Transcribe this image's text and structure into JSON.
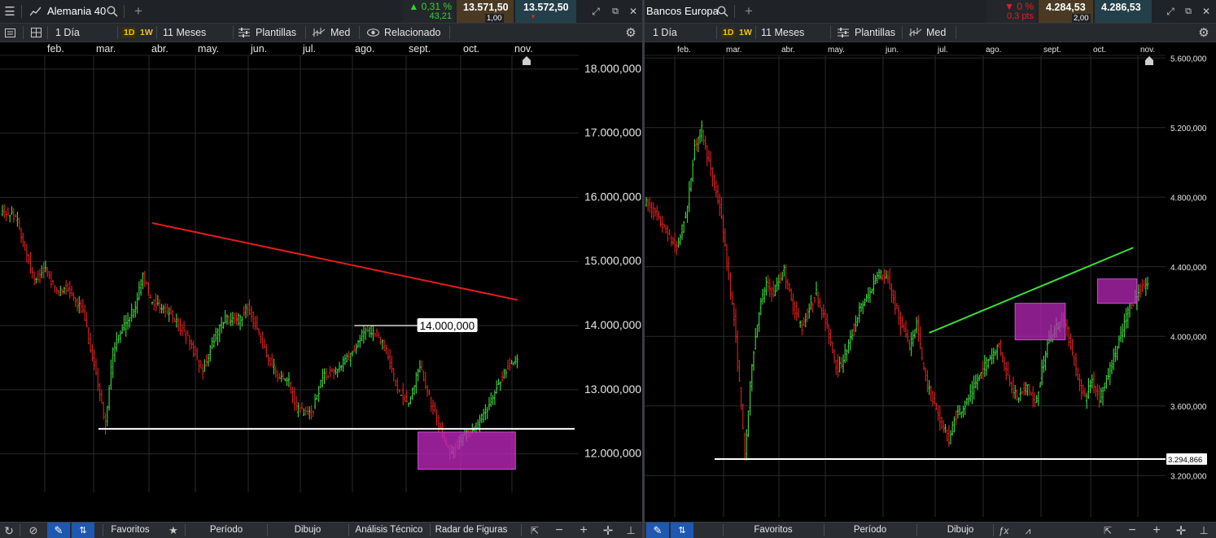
{
  "left": {
    "instrument": "Alemania 40",
    "change_pct": "0,31 %",
    "change_pts": "43,21",
    "bid": "13.571,50",
    "ask": "13.572,50",
    "spread": "1,00",
    "interval": "1 Día",
    "tf_1d": "1D",
    "tf_1w": "1W",
    "range": "11 Meses",
    "templates": "Plantillas",
    "indicator": "Med",
    "related": "Relacionado",
    "bottom": {
      "favorites": "Favoritos",
      "period": "Período",
      "drawing": "Dibujo",
      "technical": "Análisis Técnico",
      "pattern_radar": "Radar de Figuras"
    }
  },
  "right": {
    "instrument": "Bancos Europa",
    "change_pct": "0 %",
    "change_pts": "0,3 pts",
    "bid": "4.284,53",
    "ask": "4.286,53",
    "spread": "2,00",
    "interval": "1 Día",
    "tf_1d": "1D",
    "tf_1w": "1W",
    "range": "11 Meses",
    "templates": "Plantillas",
    "indicator": "Med",
    "bottom": {
      "favorites": "Favoritos",
      "period": "Período",
      "drawing": "Dibujo"
    }
  },
  "chart_data": [
    {
      "type": "ohlc",
      "instrument": "Alemania 40",
      "months": [
        "feb.",
        "mar.",
        "abr.",
        "may.",
        "jun.",
        "jul.",
        "ago.",
        "sept.",
        "oct.",
        "nov."
      ],
      "y_ticks": [
        "18.000,000",
        "17.000,000",
        "16.000,000",
        "15.000,000",
        "14.000,000",
        "13.000,000",
        "12.000,000"
      ],
      "ylim": [
        11500,
        18100
      ],
      "colors": {
        "up": "#3ddc3d",
        "down": "#e02020"
      },
      "anchors": [
        [
          0,
          15800
        ],
        [
          8,
          15700
        ],
        [
          12,
          15300
        ],
        [
          18,
          14700
        ],
        [
          24,
          14900
        ],
        [
          30,
          14500
        ],
        [
          36,
          14600
        ],
        [
          44,
          14200
        ],
        [
          52,
          13100
        ],
        [
          56,
          12450
        ],
        [
          60,
          13600
        ],
        [
          66,
          14000
        ],
        [
          72,
          14300
        ],
        [
          76,
          14800
        ],
        [
          80,
          14400
        ],
        [
          90,
          14200
        ],
        [
          100,
          13800
        ],
        [
          108,
          13300
        ],
        [
          114,
          13800
        ],
        [
          120,
          14100
        ],
        [
          128,
          14100
        ],
        [
          132,
          14300
        ],
        [
          140,
          13700
        ],
        [
          148,
          13200
        ],
        [
          154,
          13100
        ],
        [
          158,
          12700
        ],
        [
          166,
          12600
        ],
        [
          172,
          13200
        ],
        [
          178,
          13300
        ],
        [
          186,
          13500
        ],
        [
          194,
          13900
        ],
        [
          200,
          13900
        ],
        [
          206,
          13600
        ],
        [
          212,
          13000
        ],
        [
          218,
          12800
        ],
        [
          224,
          13400
        ],
        [
          230,
          12800
        ],
        [
          236,
          12300
        ],
        [
          240,
          12000
        ],
        [
          246,
          12200
        ],
        [
          252,
          12400
        ],
        [
          258,
          12600
        ],
        [
          264,
          13000
        ],
        [
          270,
          13300
        ],
        [
          275,
          13500
        ]
      ],
      "annotations": {
        "resistance_line": {
          "start_bar": 80,
          "start_price": 15600,
          "end_bar": 275,
          "end_price": 14400
        },
        "support_line_price": 12390,
        "level_line": {
          "price": 14000,
          "start_bar": 188,
          "end_bar": 222
        },
        "level_label": "14.000,000",
        "highlight_box": {
          "start_bar": 222,
          "end_bar": 274,
          "price_top": 12340,
          "price_bottom": 11760
        }
      }
    },
    {
      "type": "ohlc",
      "instrument": "Bancos Europa",
      "months": [
        "feb.",
        "mar.",
        "abr.",
        "may.",
        "jun.",
        "jul.",
        "ago.",
        "sept.",
        "oct.",
        "nov."
      ],
      "y_ticks": [
        "5.600,000",
        "5.200,000",
        "4.800,000",
        "4.400,000",
        "4.000,000",
        "3.600,000",
        "3.200,000"
      ],
      "ylim": [
        3000,
        5620
      ],
      "colors": {
        "up": "#3ddc3d",
        "down": "#e02020"
      },
      "anchors": [
        [
          0,
          4780
        ],
        [
          6,
          4700
        ],
        [
          12,
          4600
        ],
        [
          18,
          4500
        ],
        [
          24,
          4740
        ],
        [
          28,
          5100
        ],
        [
          32,
          5190
        ],
        [
          38,
          4900
        ],
        [
          42,
          4750
        ],
        [
          46,
          4420
        ],
        [
          50,
          4100
        ],
        [
          54,
          3600
        ],
        [
          56,
          3300
        ],
        [
          60,
          3850
        ],
        [
          64,
          4150
        ],
        [
          68,
          4300
        ],
        [
          72,
          4250
        ],
        [
          78,
          4380
        ],
        [
          82,
          4200
        ],
        [
          88,
          4050
        ],
        [
          96,
          4250
        ],
        [
          102,
          4050
        ],
        [
          108,
          3800
        ],
        [
          114,
          3950
        ],
        [
          120,
          4150
        ],
        [
          126,
          4250
        ],
        [
          130,
          4370
        ],
        [
          136,
          4320
        ],
        [
          142,
          4100
        ],
        [
          148,
          3950
        ],
        [
          152,
          4080
        ],
        [
          156,
          3800
        ],
        [
          160,
          3650
        ],
        [
          166,
          3500
        ],
        [
          170,
          3400
        ],
        [
          174,
          3550
        ],
        [
          180,
          3620
        ],
        [
          186,
          3750
        ],
        [
          192,
          3870
        ],
        [
          198,
          3950
        ],
        [
          202,
          3800
        ],
        [
          208,
          3640
        ],
        [
          214,
          3720
        ],
        [
          218,
          3600
        ],
        [
          222,
          3800
        ],
        [
          226,
          4000
        ],
        [
          230,
          4050
        ],
        [
          234,
          4100
        ],
        [
          238,
          3950
        ],
        [
          242,
          3750
        ],
        [
          246,
          3650
        ],
        [
          250,
          3750
        ],
        [
          254,
          3650
        ],
        [
          258,
          3750
        ],
        [
          262,
          3880
        ],
        [
          266,
          4000
        ],
        [
          270,
          4150
        ],
        [
          276,
          4250
        ],
        [
          280,
          4300
        ]
      ],
      "annotations": {
        "support_line_price": 3294.866,
        "support_label": "3.294,866",
        "trend_line": {
          "start_bar": 158,
          "start_price": 4020,
          "end_bar": 272,
          "end_price": 4510
        },
        "highlight_boxes": [
          {
            "start_bar": 206,
            "end_bar": 234,
            "price_top": 4190,
            "price_bottom": 3980
          },
          {
            "start_bar": 252,
            "end_bar": 274,
            "price_top": 4330,
            "price_bottom": 4190
          }
        ]
      }
    }
  ]
}
